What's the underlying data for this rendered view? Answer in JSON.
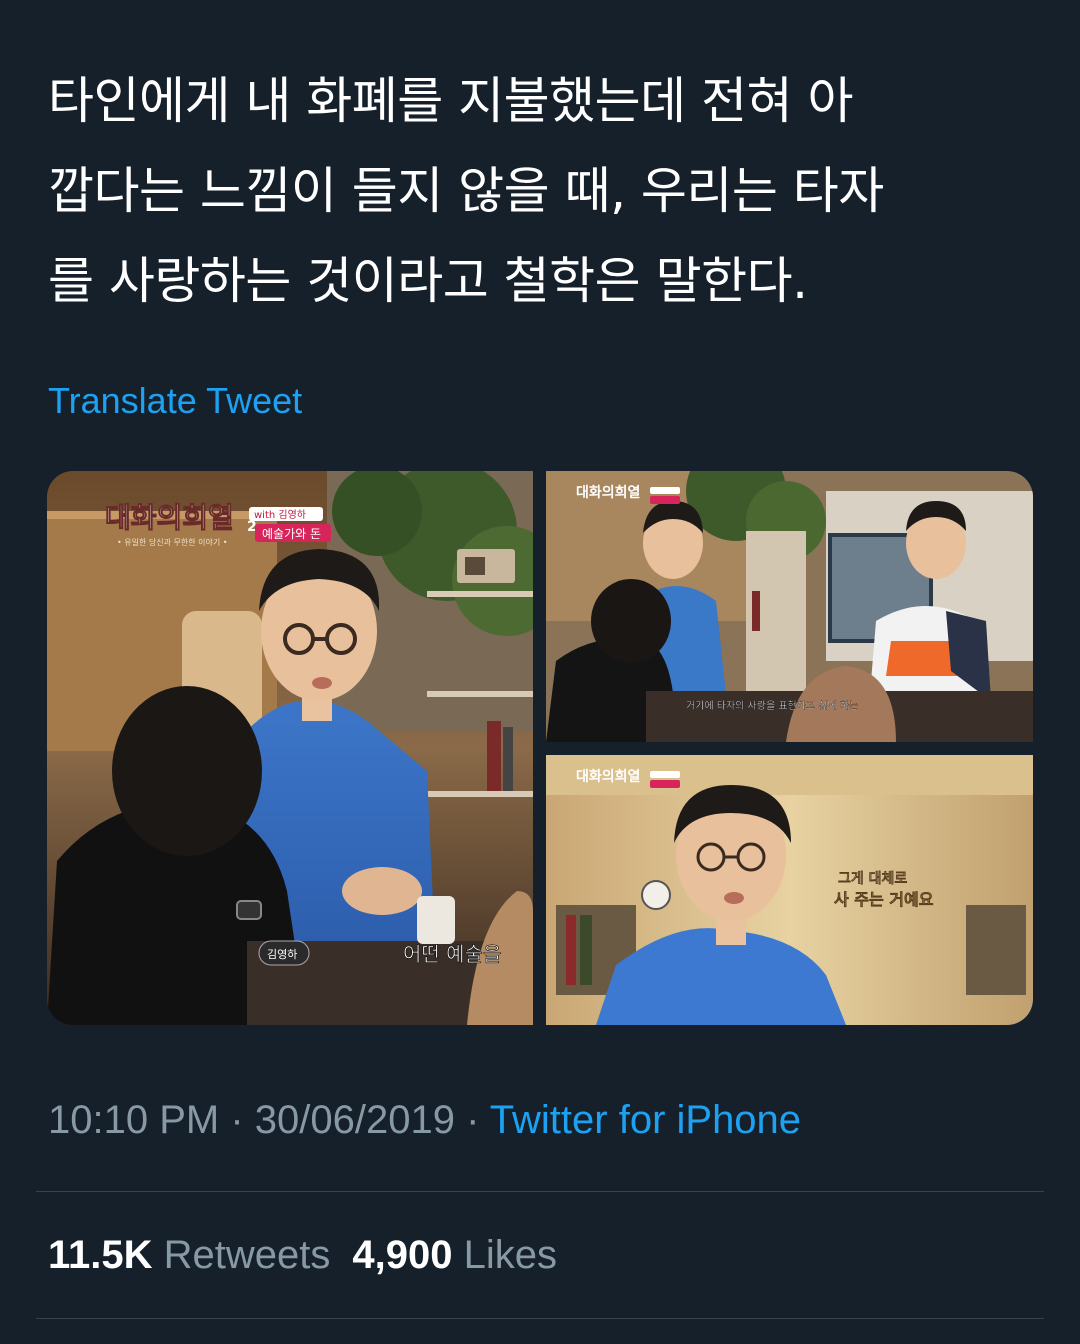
{
  "tweet": {
    "text_lines": [
      "타인에게 내 화폐를 지불했는데 전혀 아",
      "깝다는 느낌이 들지 않을 때, 우리는 타자",
      "를 사랑하는 것이라고 철학은 말한다."
    ],
    "translate_label": "Translate Tweet"
  },
  "media": {
    "image1": {
      "show_logo": "대화의희열",
      "show_logo_suffix": "2",
      "show_tagline": "• 유일한 당신과 무한한 이야기 •",
      "guest_badge": "with 김영하",
      "episode_badge": "예술가와 돈",
      "name_tag": "김영하",
      "subtitle": "어떤 예술을"
    },
    "image2": {
      "show_logo": "대화의희열",
      "subtitle": "거기에 타자의 사랑을 표현하고 싶어 하는"
    },
    "image3": {
      "show_logo": "대화의희열",
      "caption_line1": "그게 대체로",
      "caption_line2": "사 주는 거예요"
    }
  },
  "meta": {
    "time": "10:10 PM",
    "separator": " · ",
    "date": "30/06/2019",
    "source": "Twitter for iPhone"
  },
  "stats": {
    "retweets_count": "11.5K",
    "retweets_label": "Retweets",
    "likes_count": "4,900",
    "likes_label": "Likes"
  },
  "colors": {
    "background": "#15202b",
    "text": "#ffffff",
    "secondary": "#8899a6",
    "link": "#1da1f2",
    "divider": "#38444d"
  }
}
